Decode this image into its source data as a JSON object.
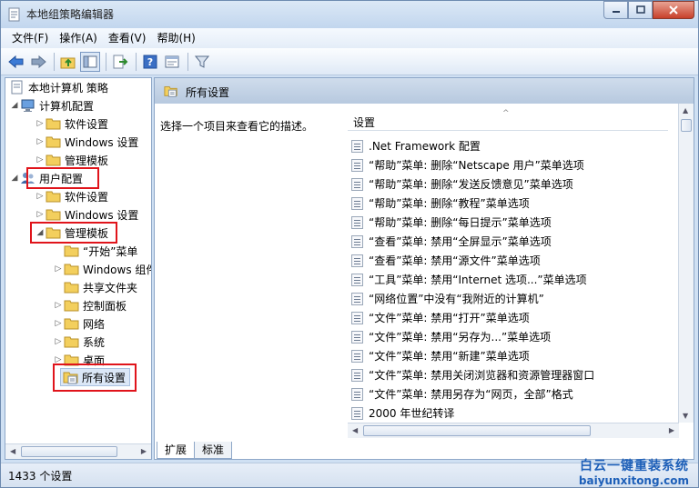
{
  "window": {
    "title": "本地组策略编辑器"
  },
  "menu": [
    "文件(F)",
    "操作(A)",
    "查看(V)",
    "帮助(H)"
  ],
  "tree": {
    "root": "本地计算机 策略",
    "computer_config": "计算机配置",
    "computer_children": [
      "软件设置",
      "Windows 设置",
      "管理模板"
    ],
    "user_config": "用户配置",
    "user_children": [
      "软件设置",
      "Windows 设置"
    ],
    "admin_templates": "管理模板",
    "admin_children": [
      "“开始”菜单",
      "Windows 组件",
      "共享文件夹",
      "控制面板",
      "网络",
      "系统",
      "桌面"
    ],
    "all_settings": "所有设置"
  },
  "right": {
    "header_title": "所有设置",
    "description": "选择一个项目来查看它的描述。",
    "column_header": "设置",
    "rows": [
      ".Net Framework 配置",
      "“帮助”菜单: 删除“Netscape 用户”菜单选项",
      "“帮助”菜单: 删除“发送反馈意见”菜单选项",
      "“帮助”菜单: 删除“教程”菜单选项",
      "“帮助”菜单: 删除“每日提示”菜单选项",
      "“查看”菜单: 禁用“全屏显示”菜单选项",
      "“查看”菜单: 禁用“源文件”菜单选项",
      "“工具”菜单: 禁用“Internet 选项...”菜单选项",
      "“网络位置”中没有“我附近的计算机”",
      "“文件”菜单: 禁用“打开”菜单选项",
      "“文件”菜单: 禁用“另存为...”菜单选项",
      "“文件”菜单: 禁用“新建”菜单选项",
      "“文件”菜单: 禁用关闭浏览器和资源管理器窗口",
      "“文件”菜单: 禁用另存为“网页，全部”格式",
      "2000 年世纪转译"
    ],
    "tabs": [
      "扩展",
      "标准"
    ]
  },
  "status": {
    "text": "1433 个设置"
  },
  "watermark": {
    "title": "白云一键重装系统",
    "url": "baiyunxitong.com"
  },
  "colors": {
    "highlight": "#e0141b",
    "folder": "#f3cf5d"
  }
}
